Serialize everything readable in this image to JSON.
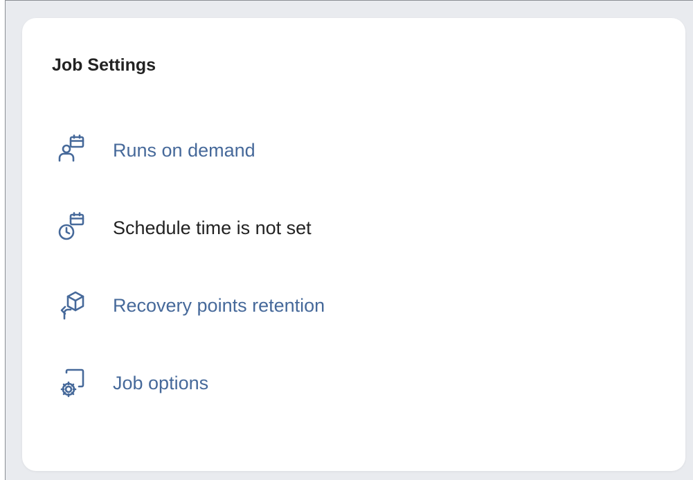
{
  "card": {
    "title": "Job Settings"
  },
  "settings": [
    {
      "label": "Runs on demand",
      "icon": "user-calendar-icon",
      "link": true
    },
    {
      "label": "Schedule time is not set",
      "icon": "clock-calendar-icon",
      "link": false
    },
    {
      "label": "Recovery points retention",
      "icon": "box-return-arrow-icon",
      "link": true
    },
    {
      "label": "Job options",
      "icon": "gear-window-icon",
      "link": true
    }
  ],
  "colors": {
    "link": "#46699a",
    "icon": "#46699a",
    "text": "#222222",
    "background": "#e9ebef",
    "card": "#ffffff"
  }
}
